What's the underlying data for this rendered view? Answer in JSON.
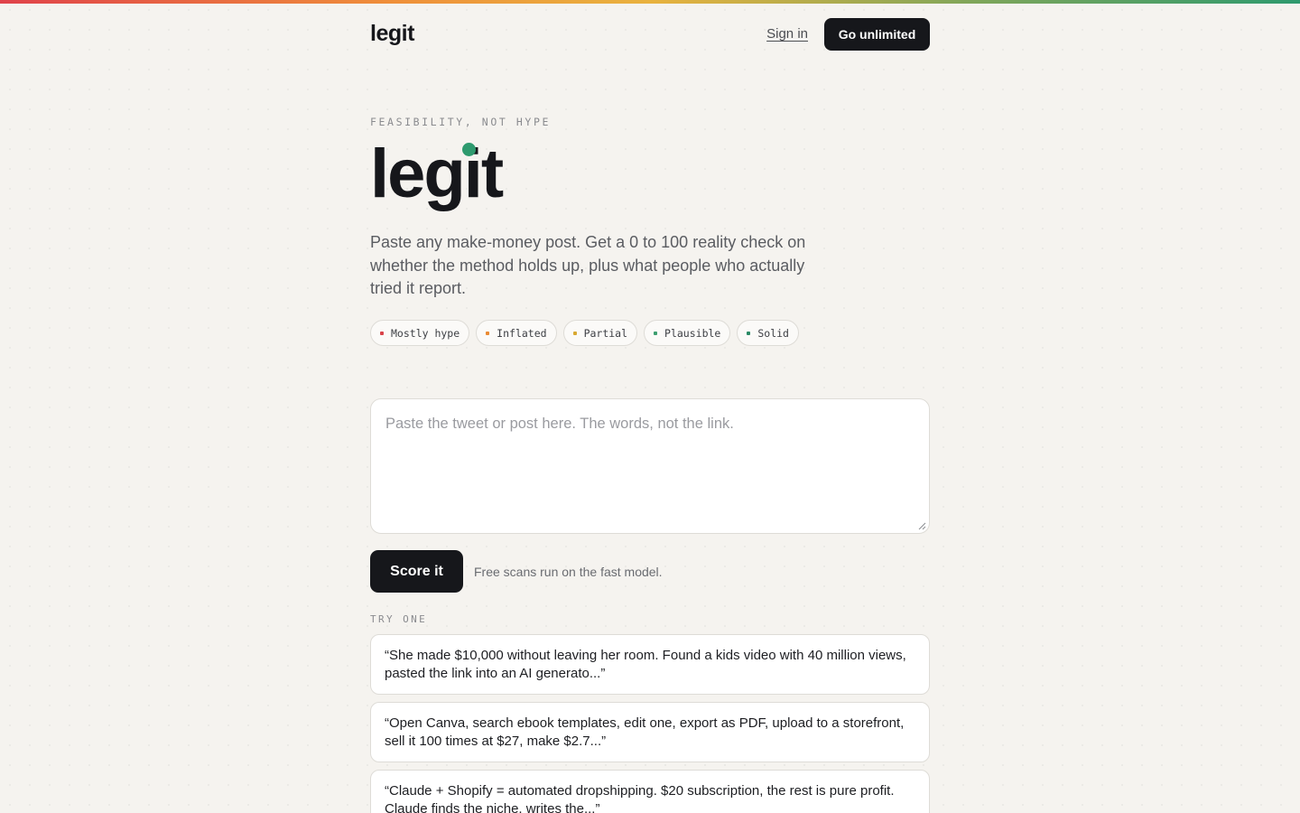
{
  "header": {
    "logo": "legit",
    "sign_in": "Sign in",
    "cta": "Go unlimited"
  },
  "hero": {
    "eyebrow": "FEASIBILITY, NOT HYPE",
    "title": "legit",
    "description": "Paste any make-money post. Get a 0 to 100 reality check on whether the method holds up, plus what people who actually tried it report."
  },
  "scale": [
    {
      "label": "Mostly hype",
      "color": "#d9434a"
    },
    {
      "label": "Inflated",
      "color": "#ea8a33"
    },
    {
      "label": "Partial",
      "color": "#d8a831"
    },
    {
      "label": "Plausible",
      "color": "#3c9e6f"
    },
    {
      "label": "Solid",
      "color": "#2a8a66"
    }
  ],
  "input": {
    "placeholder": "Paste the tweet or post here. The words, not the link.",
    "value": ""
  },
  "submit": {
    "label": "Score it",
    "note": "Free scans run on the fast model."
  },
  "examples": {
    "label": "TRY ONE",
    "items": [
      "“She made $10,000 without leaving her room. Found a kids video with 40 million views, pasted the link into an AI generato...”",
      "“Open Canva, search ebook templates, edit one, export as PDF, upload to a storefront, sell it 100 times at $27, make $2.7...”",
      "“Claude + Shopify = automated dropshipping. $20 subscription, the rest is pure profit. Claude finds the niche, writes the...”"
    ]
  },
  "colors": {
    "accent": "#2e9a6e",
    "ink": "#16171b",
    "background": "#f5f3ef"
  }
}
